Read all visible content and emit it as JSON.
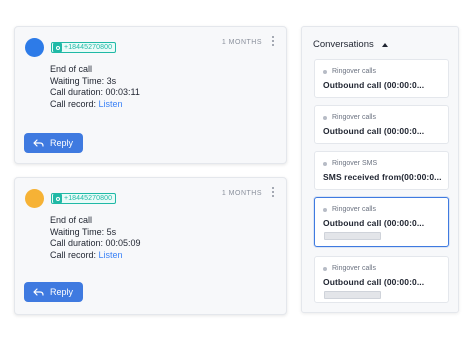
{
  "messages": [
    {
      "phone": "+18445270800",
      "time": "1 MONTHS",
      "lines": [
        "End of call",
        "Waiting Time: 3s",
        "Call duration: 00:03:11"
      ],
      "record_label": "Call record:",
      "record_link": "Listen",
      "reply_label": "Reply",
      "avatar_color": "#2d7be8"
    },
    {
      "phone": "+18445270800",
      "time": "1 MONTHS",
      "lines": [
        "End of call",
        "Waiting Time: 5s",
        "Call duration: 00:05:09"
      ],
      "record_label": "Call record:",
      "record_link": "Listen",
      "reply_label": "Reply",
      "avatar_color": "#f6b235"
    }
  ],
  "conversations": {
    "title": "Conversations",
    "items": [
      {
        "source": "Ringover calls",
        "title": "Outbound call (00:00:0...",
        "selected": false
      },
      {
        "source": "Ringover calls",
        "title": "Outbound call (00:00:0...",
        "selected": false
      },
      {
        "source": "Ringover SMS",
        "title": "SMS received from(00:00:0...",
        "selected": false
      },
      {
        "source": "Ringover calls",
        "title": "Outbound call (00:00:0...",
        "selected": true
      },
      {
        "source": "Ringover calls",
        "title": "Outbound call (00:00:0...",
        "selected": false
      }
    ]
  },
  "colors": {
    "accent": "#3f7ae0",
    "tag": "#1fb9a6",
    "link": "#3b82f6"
  }
}
